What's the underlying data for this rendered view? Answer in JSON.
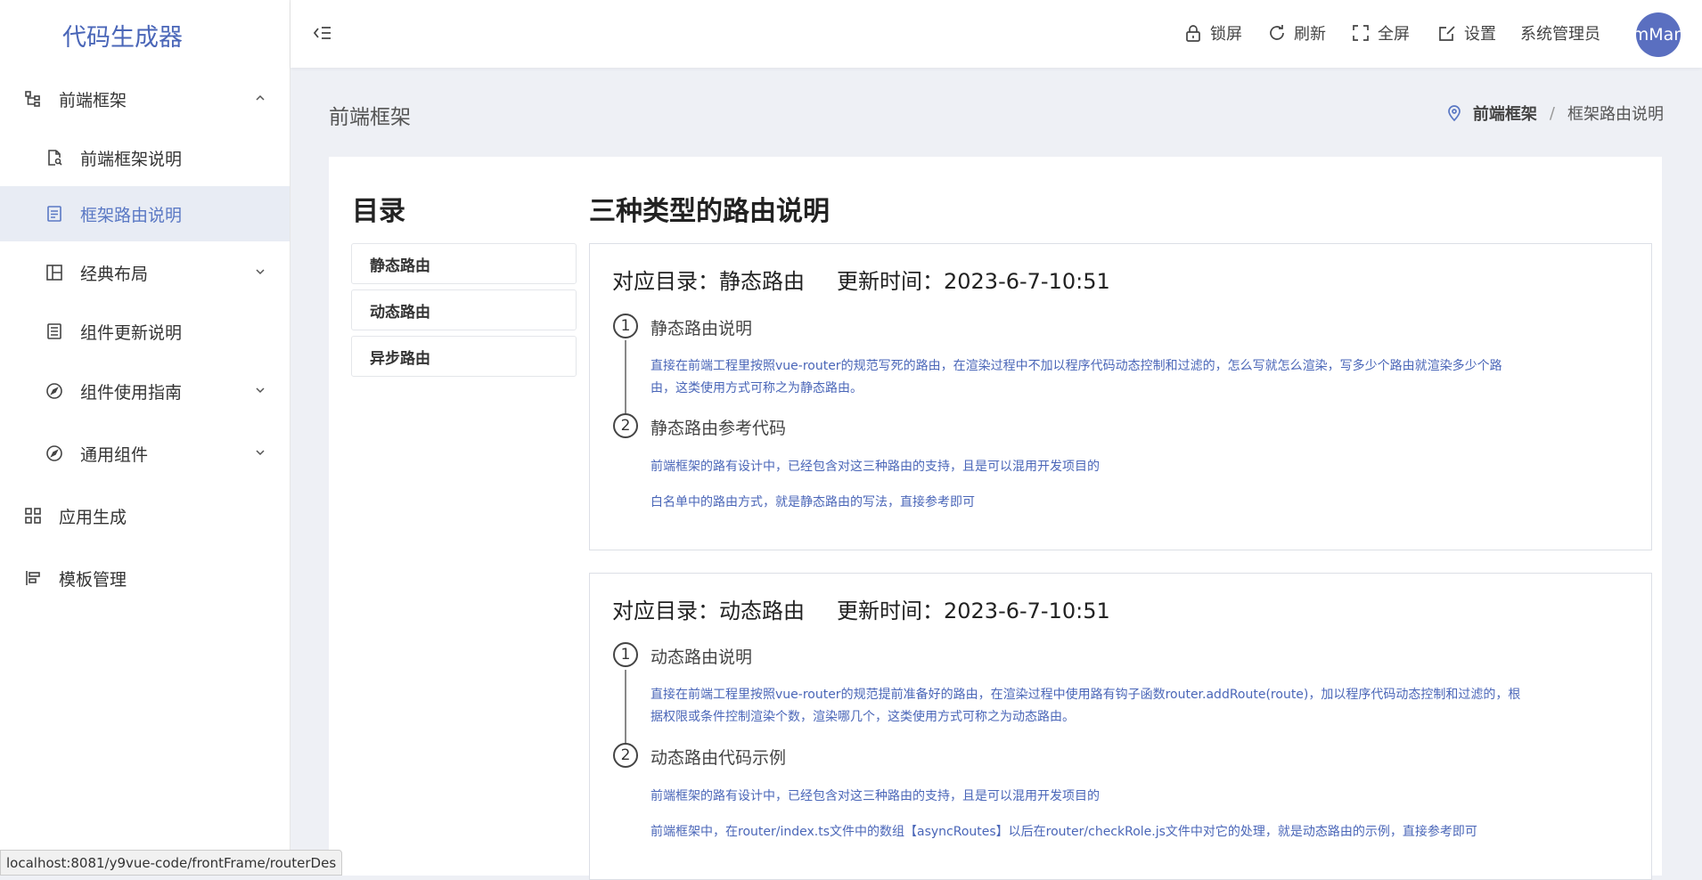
{
  "app": {
    "title": "代码生成器"
  },
  "sidebar": {
    "items": [
      {
        "label": "前端框架",
        "icon": "tree-structure-icon",
        "expanded": true
      },
      {
        "label": "前端框架说明",
        "icon": "document-search-icon"
      },
      {
        "label": "框架路由说明",
        "icon": "document-list-icon",
        "active": true
      },
      {
        "label": "经典布局",
        "icon": "layout-icon"
      },
      {
        "label": "组件更新说明",
        "icon": "document-icon"
      },
      {
        "label": "组件使用指南",
        "icon": "compass-icon"
      },
      {
        "label": "通用组件",
        "icon": "compass-icon"
      },
      {
        "label": "应用生成",
        "icon": "grid-icon"
      },
      {
        "label": "模板管理",
        "icon": "template-icon"
      }
    ]
  },
  "header": {
    "lock_label": "锁屏",
    "refresh_label": "刷新",
    "fullscreen_label": "全屏",
    "settings_label": "设置",
    "user_name": "系统管理员",
    "avatar_text": "mMan"
  },
  "page": {
    "title": "前端框架",
    "breadcrumb": {
      "parent": "前端框架",
      "separator": "/",
      "current": "框架路由说明"
    }
  },
  "toc": {
    "title": "目录",
    "items": [
      "静态路由",
      "动态路由",
      "异步路由"
    ]
  },
  "doc": {
    "title": "三种类型的路由说明",
    "sections": [
      {
        "catalog": "对应目录：静态路由",
        "updated": "更新时间：2023-6-7-10:51",
        "steps": [
          {
            "num": "1",
            "title": "静态路由说明",
            "lines": [
              "直接在前端工程里按照vue-router的规范写死的路由，在渲染过程中不加以程序代码动态控制和过滤的，怎么写就怎么渲染，写多少个路由就渲染多少个路由，这类使用方式可称之为静态路由。"
            ]
          },
          {
            "num": "2",
            "title": "静态路由参考代码",
            "lines": [
              "前端框架的路有设计中，已经包含对这三种路由的支持，且是可以混用开发项目的",
              "白名单中的路由方式，就是静态路由的写法，直接参考即可"
            ]
          }
        ]
      },
      {
        "catalog": "对应目录：动态路由",
        "updated": "更新时间：2023-6-7-10:51",
        "steps": [
          {
            "num": "1",
            "title": "动态路由说明",
            "lines": [
              "直接在前端工程里按照vue-router的规范提前准备好的路由，在渲染过程中使用路有钩子函数router.addRoute(route)，加以程序代码动态控制和过滤的，根据权限或条件控制渲染个数，渲染哪几个，这类使用方式可称之为动态路由。"
            ]
          },
          {
            "num": "2",
            "title": "动态路由代码示例",
            "lines": [
              "前端框架的路有设计中，已经包含对这三种路由的支持，且是可以混用开发项目的",
              "前端框架中，在router/index.ts文件中的数组【asyncRoutes】以后在router/checkRole.js文件中对它的处理，就是动态路由的示例，直接参考即可"
            ]
          }
        ]
      }
    ]
  },
  "status_bar": {
    "url": "localhost:8081/y9vue-code/frontFrame/routerDes"
  },
  "colors": {
    "accent": "#4a66b8",
    "active_bg": "#e8ecf4",
    "avatar_bg": "#5a6fc0"
  }
}
